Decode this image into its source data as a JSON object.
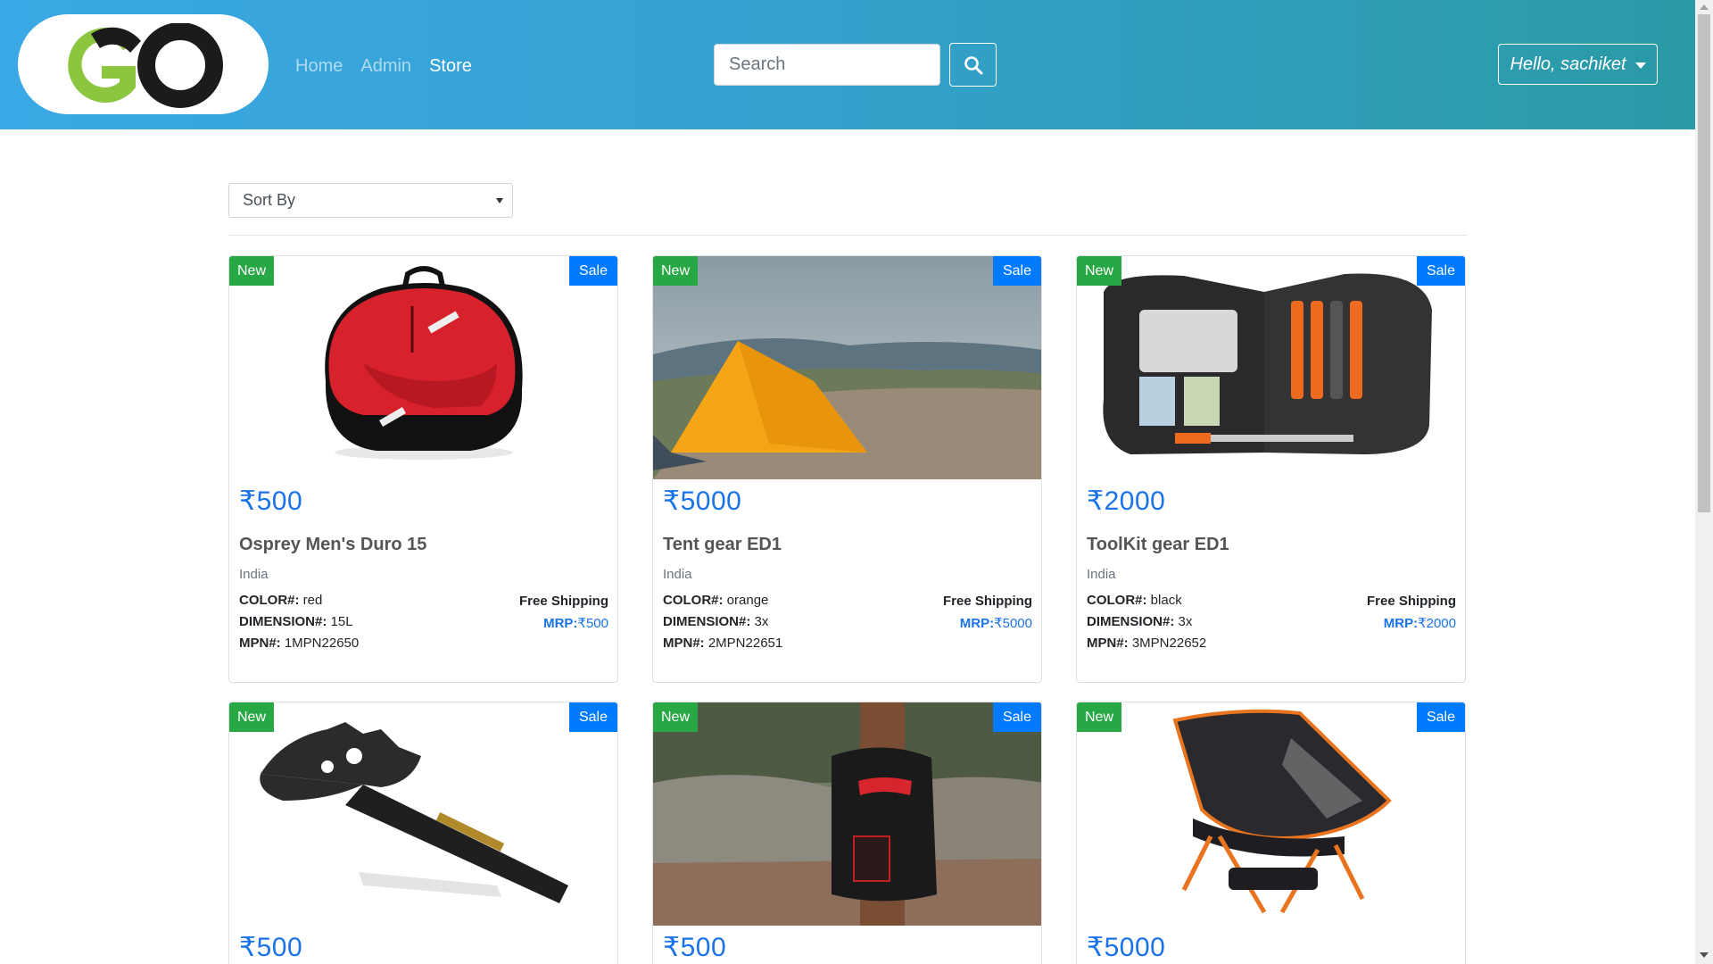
{
  "nav": {
    "links": [
      "Home",
      "Admin",
      "Store"
    ],
    "search_placeholder": "Search",
    "user_greeting": "Hello, sachiket"
  },
  "toolbar": {
    "sort_label": "Sort By"
  },
  "labels": {
    "badge_new": "New",
    "badge_sale": "Sale",
    "free_shipping": "Free Shipping",
    "color": "COLOR#:",
    "dimension": "DIMENSION#:",
    "mpn": "MPN#:",
    "mrp": "MRP:"
  },
  "products": [
    {
      "price": "₹500",
      "name": "Osprey Men's Duro 15",
      "origin": "India",
      "color": "red",
      "dimension": "15L",
      "mpn": "1MPN22650",
      "mrp": "₹500",
      "image": "red-backpack"
    },
    {
      "price": "₹5000",
      "name": "Tent gear ED1",
      "origin": "India",
      "color": "orange",
      "dimension": "3x",
      "mpn": "2MPN22651",
      "mrp": "₹5000",
      "image": "yellow-tent"
    },
    {
      "price": "₹2000",
      "name": "ToolKit gear ED1",
      "origin": "India",
      "color": "black",
      "dimension": "3x",
      "mpn": "3MPN22652",
      "mrp": "₹2000",
      "image": "kitchen-toolkit"
    },
    {
      "price": "₹500",
      "image": "multi-tool-axe"
    },
    {
      "price": "₹500",
      "image": "solar-shower-bag"
    },
    {
      "price": "₹5000",
      "image": "folding-camp-chair"
    }
  ]
}
